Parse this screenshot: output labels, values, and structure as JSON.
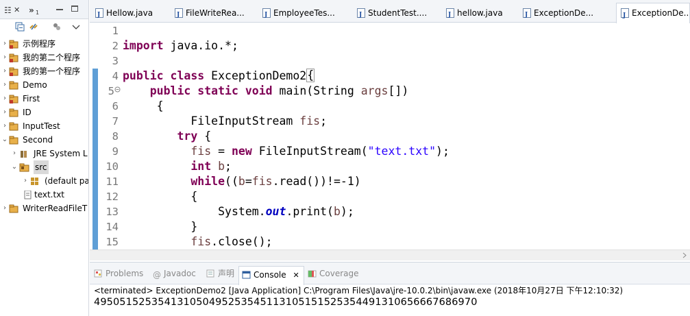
{
  "package_explorer": {
    "tab_label": "☷",
    "tab_close": "✕",
    "overflow_label": "»",
    "overflow_count": "1",
    "tree": [
      {
        "label": "示例程序",
        "arrow": "›"
      },
      {
        "label": "我的第二个程序",
        "arrow": "›"
      },
      {
        "label": "我的第一个程序",
        "arrow": "›"
      },
      {
        "label": "Demo",
        "arrow": "›"
      },
      {
        "label": "First",
        "arrow": "›"
      },
      {
        "label": "ID",
        "arrow": "›"
      },
      {
        "label": "InputTest",
        "arrow": "›"
      },
      {
        "label": "Second",
        "arrow": "⌄"
      },
      {
        "label": "JRE System L",
        "arrow": "›"
      },
      {
        "label": "src",
        "arrow": "⌄"
      },
      {
        "label": "(default pa",
        "arrow": "›"
      },
      {
        "label": "text.txt",
        "arrow": ""
      },
      {
        "label": "WriterReadFileT",
        "arrow": "›"
      }
    ]
  },
  "editor_tabs": [
    {
      "label": "Hellow.java"
    },
    {
      "label": "FileWriteRea..."
    },
    {
      "label": "EmployeeTes..."
    },
    {
      "label": "StudentTest...."
    },
    {
      "label": "hellow.java"
    },
    {
      "label": "ExceptionDe..."
    },
    {
      "label": "ExceptionDe..."
    }
  ],
  "code": {
    "line_numbers": [
      "1",
      "2",
      "3",
      "4",
      "5",
      "6",
      "7",
      "8",
      "9",
      "10",
      "11",
      "12",
      "13",
      "14",
      "15"
    ],
    "lines": {
      "l2_kw": "import",
      "l2_rest": " java.io.*;",
      "l4_kw1": "public",
      "l4_kw2": "class",
      "l4_name": " ExceptionDemo2",
      "l4_brace": "{",
      "l5_kw1": "public",
      "l5_kw2": "static",
      "l5_kw3": "void",
      "l5_rest": " main(String ",
      "l5_args": "args",
      "l5_end": "[])",
      "l6": "{",
      "l7_type": "FileInputStream ",
      "l7_var": "fis",
      "l7_end": ";",
      "l8_kw": "try",
      "l8_rest": " {",
      "l9_var": "fis",
      "l9_mid": " = ",
      "l9_kw": "new",
      "l9_rest": " FileInputStream(",
      "l9_str": "\"text.txt\"",
      "l9_end": ");",
      "l10_kw": "int",
      "l10_var": " b",
      "l10_end": ";",
      "l11_kw": "while",
      "l11_a": "((",
      "l11_b": "b",
      "l11_c": "=",
      "l11_d": "fis",
      "l11_e": ".read())!=-1)",
      "l12": "{",
      "l13_a": "System.",
      "l13_fld": "out",
      "l13_b": ".print(",
      "l13_var": "b",
      "l13_c": ");",
      "l14": "}",
      "l15_var": "fis",
      "l15_rest": ".close();"
    }
  },
  "console": {
    "tabs": [
      "Problems",
      "Javadoc",
      "声明",
      "Console",
      "Coverage"
    ],
    "console_close": "✕",
    "terminated_line": "<terminated> ExceptionDemo2 [Java Application] C:\\Program Files\\Java\\jre-10.0.2\\bin\\javaw.exe (2018年10月27日 下午12:10:32)",
    "output": "495051525354131050495253545113105151525354491310656667686970"
  },
  "colors": {
    "keyword": "#7f0055",
    "string": "#2a00ff",
    "variable": "#6a3e3e",
    "field": "#0000c0",
    "ruler_mark": "#5f9fd6"
  }
}
